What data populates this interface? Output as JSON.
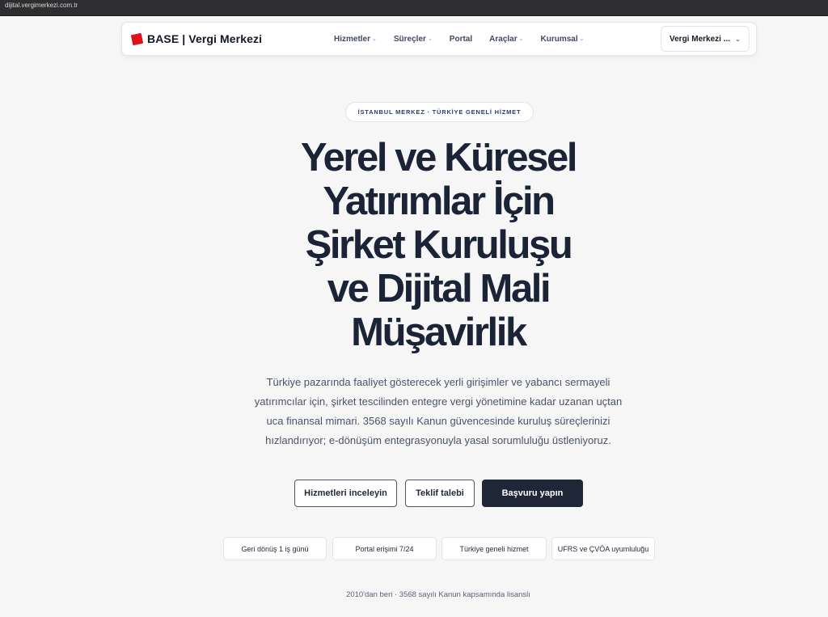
{
  "browser": {
    "url": "dijital.vergimerkezi.com.tr"
  },
  "navbar": {
    "brand": "BASE | Vergi Merkezi",
    "links": [
      {
        "label": "Hizmetler",
        "has_dropdown": true
      },
      {
        "label": "Süreçler",
        "has_dropdown": true
      },
      {
        "label": "Portal",
        "has_dropdown": false
      },
      {
        "label": "Araçlar",
        "has_dropdown": true
      },
      {
        "label": "Kurumsal",
        "has_dropdown": true
      }
    ],
    "branch_select": "Vergi Merkezi ..."
  },
  "hero": {
    "eyebrow": "İSTANBUL MERKEZ · TÜRKİYE GENELİ HİZMET",
    "headline_lines": [
      "Yerel ve Küresel",
      "Yatırımlar İçin",
      "Şirket Kuruluşu",
      "ve Dijital Mali",
      "Müşavirlik"
    ],
    "lead_lines": [
      "Türkiye pazarında faaliyet gösterecek yerli girişimler ve yabancı sermayeli",
      "yatırımcılar için, şirket tescilinden entegre vergi yönetimine kadar uzanan uçtan",
      "uca finansal mimari. 3568 sayılı Kanun güvencesinde kuruluş süreçlerinizi",
      "hızlandırıyor; e-dönüşüm entegrasyonuyla yasal sorumluluğu üstleniyoruz."
    ]
  },
  "actions": {
    "services_label": "Hizmetleri inceleyin",
    "quote_label": "Teklif talebi",
    "apply_label": "Başvuru yapın"
  },
  "chips": [
    "Geri dönüş 1 iş günü",
    "Portal erişimi 7/24",
    "Türkiye geneli hizmet",
    "UFRS ve ÇVÖA uyumluluğu"
  ],
  "footnote": "2010'dan beri · 3568 sayılı Kanun kapsamında lisanslı",
  "colors": {
    "brand_red": "#e0111b",
    "navy": "#1e2638",
    "background": "#f6f6f7"
  }
}
